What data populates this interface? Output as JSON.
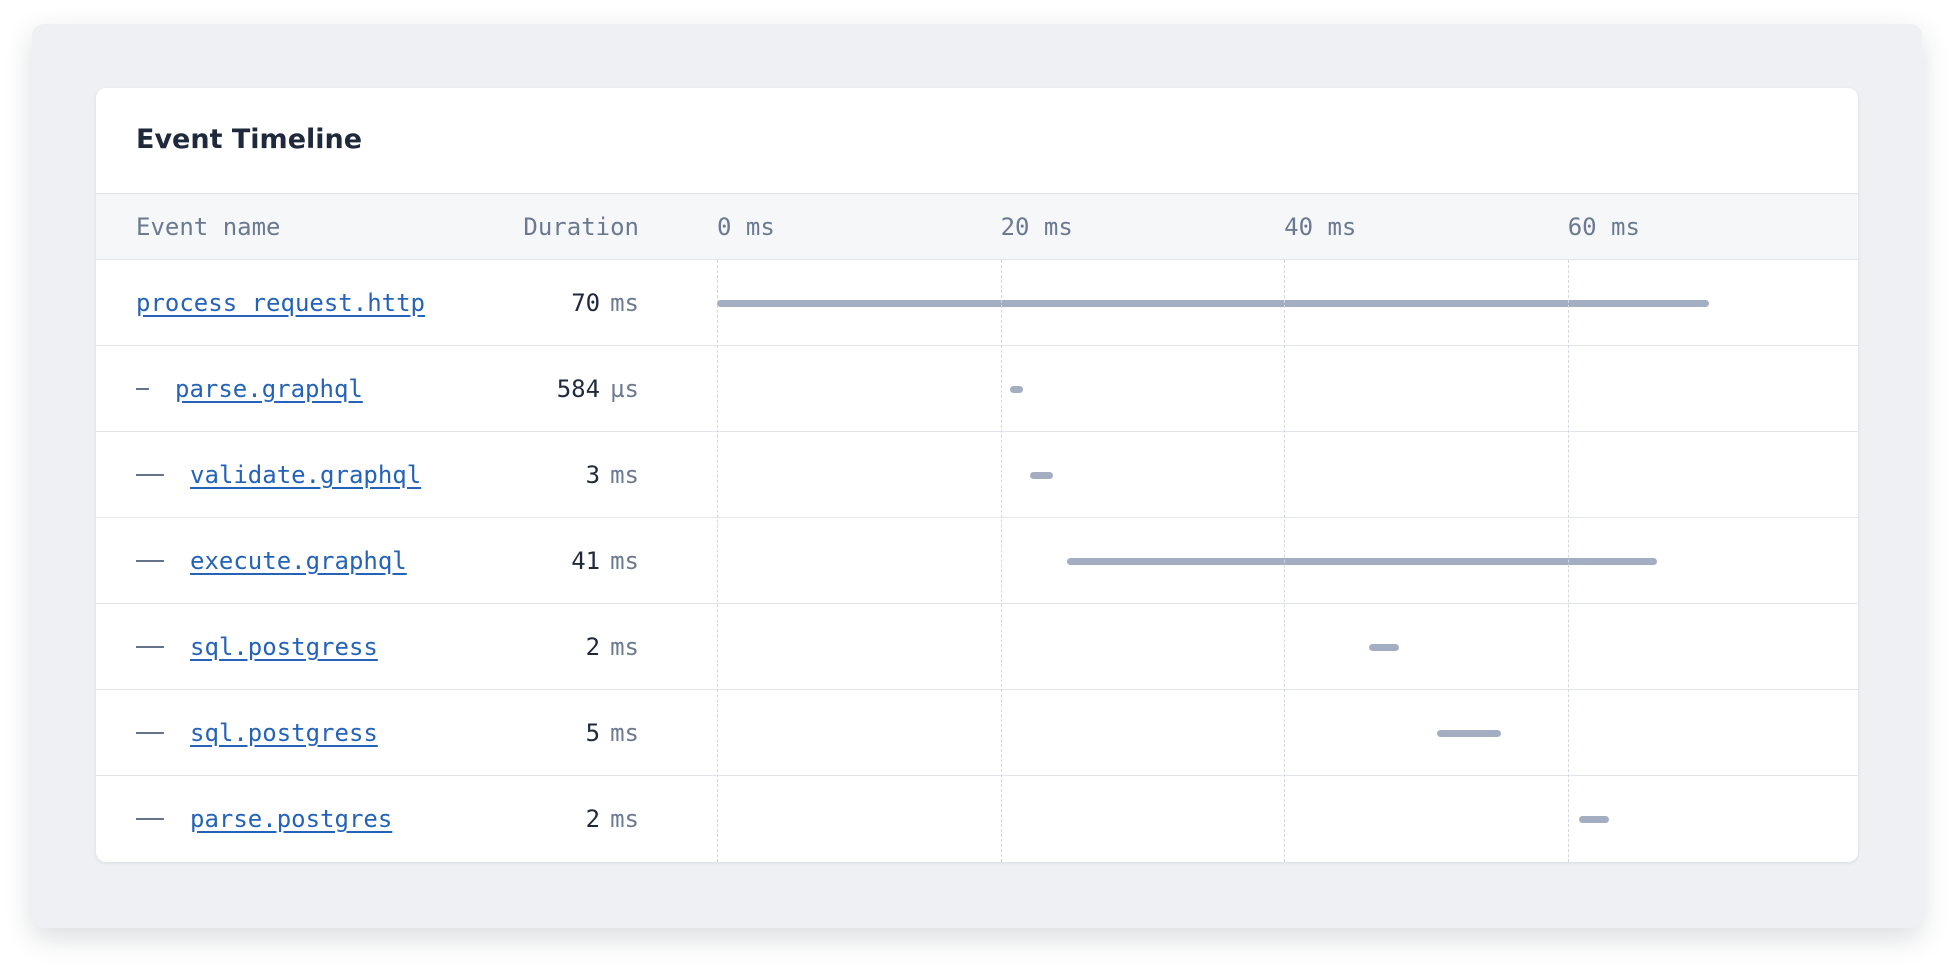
{
  "title": "Event Timeline",
  "columns": {
    "name": "Event name",
    "duration": "Duration"
  },
  "timeline": {
    "max_ms": 78.5,
    "ticks": [
      {
        "value": 0,
        "label": "0 ms"
      },
      {
        "value": 20,
        "label": "20 ms"
      },
      {
        "value": 40,
        "label": "40 ms"
      },
      {
        "value": 60,
        "label": "60 ms"
      }
    ]
  },
  "events": [
    {
      "name": "process_request.http",
      "depth": 0,
      "duration_value": "70",
      "duration_unit": "ms",
      "start_ms": 0,
      "duration_ms": 70
    },
    {
      "name": "parse.graphql",
      "depth": 1,
      "duration_value": "584",
      "duration_unit": "µs",
      "start_ms": 20.7,
      "duration_ms": 0.584
    },
    {
      "name": "validate.graphql",
      "depth": 2,
      "duration_value": "3",
      "duration_unit": "ms",
      "start_ms": 22.1,
      "duration_ms": 1.6
    },
    {
      "name": "execute.graphql",
      "depth": 2,
      "duration_value": "41",
      "duration_unit": "ms",
      "start_ms": 24.7,
      "duration_ms": 41.6
    },
    {
      "name": "sql.postgress",
      "depth": 2,
      "duration_value": "2",
      "duration_unit": "ms",
      "start_ms": 46.0,
      "duration_ms": 2.1
    },
    {
      "name": "sql.postgress",
      "depth": 2,
      "duration_value": "5",
      "duration_unit": "ms",
      "start_ms": 50.8,
      "duration_ms": 4.5
    },
    {
      "name": "parse.postgres",
      "depth": 2,
      "duration_value": "2",
      "duration_unit": "ms",
      "start_ms": 60.8,
      "duration_ms": 2.1
    }
  ]
}
